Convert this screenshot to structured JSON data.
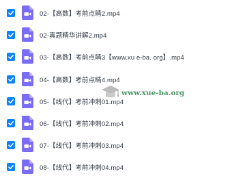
{
  "files": [
    {
      "name": "02-【高数】考前点睛2.mp4",
      "checked": true
    },
    {
      "name": "02-真题精华讲解2.mp4",
      "checked": true
    },
    {
      "name": "03-【高数】考前点睛3【www.xu e-ba. org】.mp4",
      "checked": true
    },
    {
      "name": "04-【高数】考前点睛4.mp4",
      "checked": true
    },
    {
      "name": "05-【线代】考前冲刺01.mp4",
      "checked": true
    },
    {
      "name": "06-【线代】考前冲刺02.mp4",
      "checked": true
    },
    {
      "name": "07-【线代】考前冲刺03.mp4",
      "checked": true
    },
    {
      "name": "08-【线代】考前冲刺04.mp4",
      "checked": true
    }
  ],
  "watermark": {
    "text": "www.xue-ba.org"
  },
  "colors": {
    "checkbox": "#0a84ff",
    "video_icon": "#7b6cf6",
    "text": "#333a44",
    "watermark": "#1a7a3c"
  },
  "icons": {
    "checkbox": "checkmark-icon",
    "file": "video-file-icon",
    "watermark": "graduation-cap-icon"
  }
}
